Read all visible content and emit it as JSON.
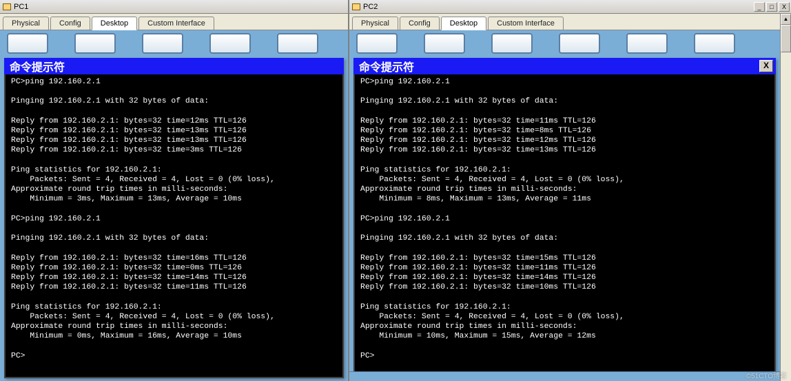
{
  "watermark": "©51CTO博客",
  "pc1": {
    "title": "PC1",
    "tabs": [
      "Physical",
      "Config",
      "Desktop",
      "Custom Interface"
    ],
    "active_tab": 2,
    "cmd_title": "命令提示符",
    "term": "PC>ping 192.160.2.1\n\nPinging 192.160.2.1 with 32 bytes of data:\n\nReply from 192.160.2.1: bytes=32 time=12ms TTL=126\nReply from 192.160.2.1: bytes=32 time=13ms TTL=126\nReply from 192.160.2.1: bytes=32 time=13ms TTL=126\nReply from 192.160.2.1: bytes=32 time=3ms TTL=126\n\nPing statistics for 192.160.2.1:\n    Packets: Sent = 4, Received = 4, Lost = 0 (0% loss),\nApproximate round trip times in milli-seconds:\n    Minimum = 3ms, Maximum = 13ms, Average = 10ms\n\nPC>ping 192.160.2.1\n\nPinging 192.160.2.1 with 32 bytes of data:\n\nReply from 192.160.2.1: bytes=32 time=16ms TTL=126\nReply from 192.160.2.1: bytes=32 time=0ms TTL=126\nReply from 192.160.2.1: bytes=32 time=14ms TTL=126\nReply from 192.160.2.1: bytes=32 time=11ms TTL=126\n\nPing statistics for 192.160.2.1:\n    Packets: Sent = 4, Received = 4, Lost = 0 (0% loss),\nApproximate round trip times in milli-seconds:\n    Minimum = 0ms, Maximum = 16ms, Average = 10ms\n\nPC>"
  },
  "pc2": {
    "title": "PC2",
    "os_controls": {
      "min": "_",
      "max": "□",
      "close": "X"
    },
    "tabs": [
      "Physical",
      "Config",
      "Desktop",
      "Custom Interface"
    ],
    "active_tab": 2,
    "cmd_title": "命令提示符",
    "cmd_close": "X",
    "term": "PC>ping 192.160.2.1\n\nPinging 192.160.2.1 with 32 bytes of data:\n\nReply from 192.160.2.1: bytes=32 time=11ms TTL=126\nReply from 192.160.2.1: bytes=32 time=8ms TTL=126\nReply from 192.160.2.1: bytes=32 time=12ms TTL=126\nReply from 192.160.2.1: bytes=32 time=13ms TTL=126\n\nPing statistics for 192.160.2.1:\n    Packets: Sent = 4, Received = 4, Lost = 0 (0% loss),\nApproximate round trip times in milli-seconds:\n    Minimum = 8ms, Maximum = 13ms, Average = 11ms\n\nPC>ping 192.160.2.1\n\nPinging 192.160.2.1 with 32 bytes of data:\n\nReply from 192.160.2.1: bytes=32 time=15ms TTL=126\nReply from 192.160.2.1: bytes=32 time=11ms TTL=126\nReply from 192.160.2.1: bytes=32 time=14ms TTL=126\nReply from 192.160.2.1: bytes=32 time=10ms TTL=126\n\nPing statistics for 192.160.2.1:\n    Packets: Sent = 4, Received = 4, Lost = 0 (0% loss),\nApproximate round trip times in milli-seconds:\n    Minimum = 10ms, Maximum = 15ms, Average = 12ms\n\nPC>"
  }
}
